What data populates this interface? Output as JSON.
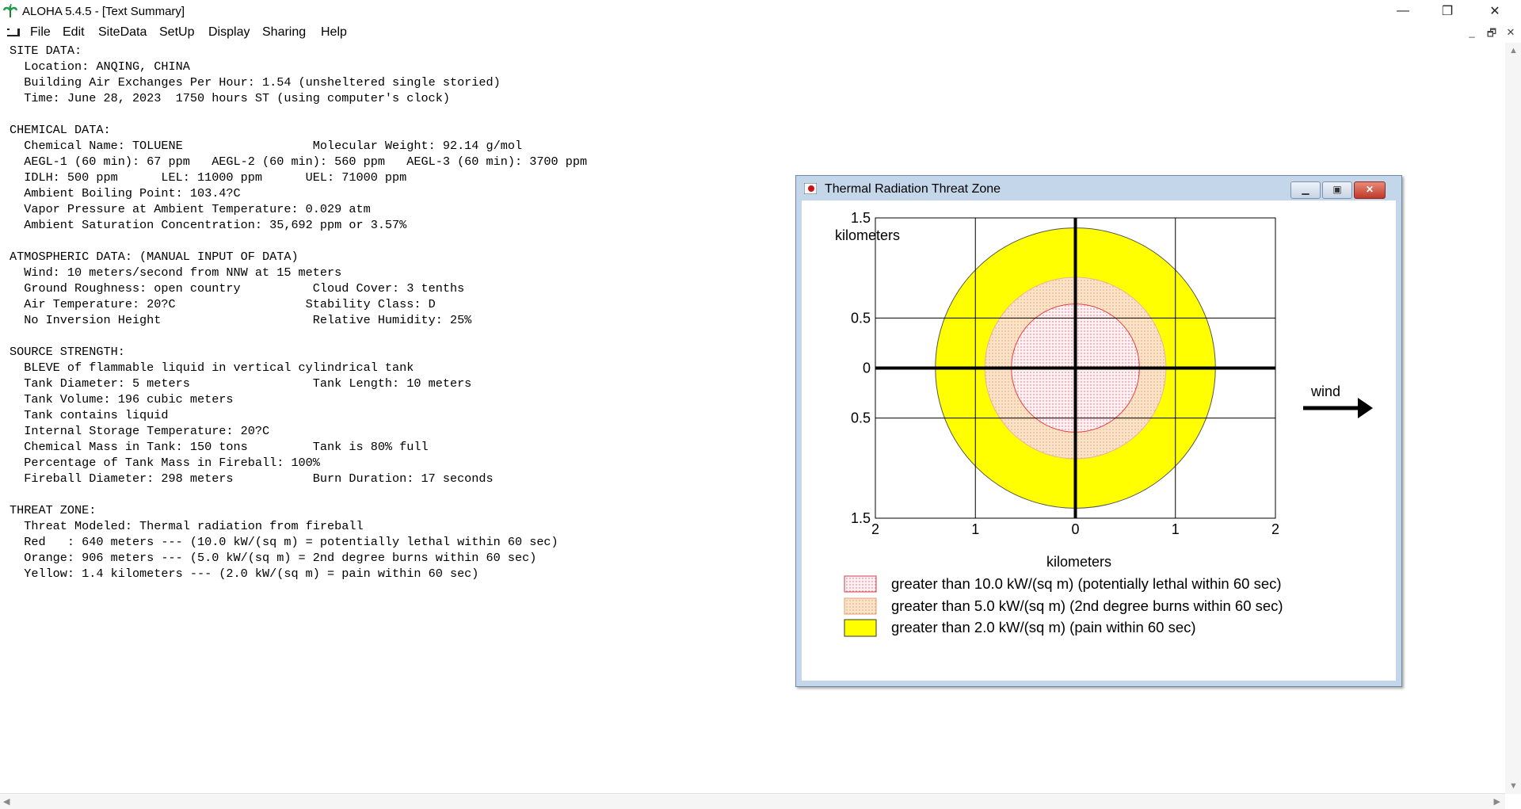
{
  "window": {
    "title": "ALOHA 5.4.5 - [Text Summary]",
    "controls": {
      "minimize": "—",
      "restore": "❐",
      "close": "✕"
    }
  },
  "menu": {
    "items": [
      "File",
      "Edit",
      "SiteData",
      "SetUp",
      "Display",
      "Sharing",
      "Help"
    ],
    "mdi": {
      "minimize": "_",
      "restore": "🗗",
      "close": "✕"
    }
  },
  "summary_text": "SITE DATA:\n  Location: ANQING, CHINA\n  Building Air Exchanges Per Hour: 1.54 (unsheltered single storied)\n  Time: June 28, 2023  1750 hours ST (using computer's clock)\n\nCHEMICAL DATA:\n  Chemical Name: TOLUENE                  Molecular Weight: 92.14 g/mol\n  AEGL-1 (60 min): 67 ppm   AEGL-2 (60 min): 560 ppm   AEGL-3 (60 min): 3700 ppm\n  IDLH: 500 ppm      LEL: 11000 ppm      UEL: 71000 ppm\n  Ambient Boiling Point: 103.4?C\n  Vapor Pressure at Ambient Temperature: 0.029 atm\n  Ambient Saturation Concentration: 35,692 ppm or 3.57%\n\nATMOSPHERIC DATA: (MANUAL INPUT OF DATA)\n  Wind: 10 meters/second from NNW at 15 meters\n  Ground Roughness: open country          Cloud Cover: 3 tenths\n  Air Temperature: 20?C                  Stability Class: D\n  No Inversion Height                     Relative Humidity: 25%\n\nSOURCE STRENGTH:\n  BLEVE of flammable liquid in vertical cylindrical tank\n  Tank Diameter: 5 meters                 Tank Length: 10 meters\n  Tank Volume: 196 cubic meters\n  Tank contains liquid\n  Internal Storage Temperature: 20?C\n  Chemical Mass in Tank: 150 tons         Tank is 80% full\n  Percentage of Tank Mass in Fireball: 100%\n  Fireball Diameter: 298 meters           Burn Duration: 17 seconds\n\nTHREAT ZONE:\n  Threat Modeled: Thermal radiation from fireball\n  Red   : 640 meters --- (10.0 kW/(sq m) = potentially lethal within 60 sec)\n  Orange: 906 meters --- (5.0 kW/(sq m) = 2nd degree burns within 60 sec)\n  Yellow: 1.4 kilometers --- (2.0 kW/(sq m) = pain within 60 sec)",
  "threat_window": {
    "title": "Thermal Radiation Threat Zone",
    "wind_label": "wind",
    "y_unit": "kilometers",
    "x_unit": "kilometers",
    "y_ticks": [
      "1.5",
      "0.5",
      "0",
      "0.5",
      "1.5"
    ],
    "x_ticks": [
      "2",
      "1",
      "0",
      "1",
      "2"
    ],
    "legend": [
      "greater than 10.0 kW/(sq m) (potentially lethal within 60 sec)",
      "greater than 5.0 kW/(sq m) (2nd degree burns within 60 sec)",
      "greater than 2.0 kW/(sq m) (pain within 60 sec)"
    ]
  },
  "chart_data": {
    "type": "threat-zone",
    "xlim": [
      -2,
      2
    ],
    "ylim": [
      -1.5,
      1.5
    ],
    "x_ticks": [
      -2,
      -1,
      0,
      1,
      2
    ],
    "y_ticks": [
      -1.5,
      -0.5,
      0,
      0.5,
      1.5
    ],
    "units": "km",
    "zones": [
      {
        "level": "yellow",
        "radius_km": 1.4,
        "fill": "#ffff00",
        "stroke": "#555555",
        "pattern": "solid"
      },
      {
        "level": "orange",
        "radius_km": 0.906,
        "fill": "#f5dcc0",
        "stroke": "#f0b090",
        "pattern": "dots"
      },
      {
        "level": "red",
        "radius_km": 0.64,
        "fill": "#fbe8ee",
        "stroke": "#e04040",
        "pattern": "dots"
      }
    ],
    "grid": true
  }
}
